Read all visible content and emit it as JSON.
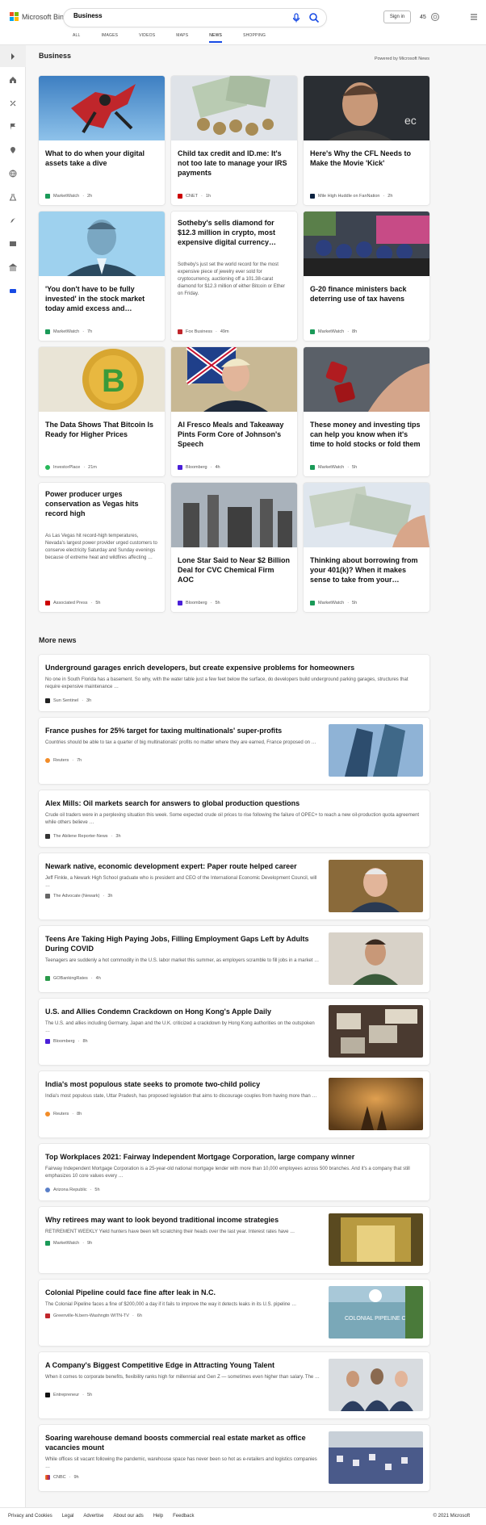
{
  "header": {
    "logo_text": "Microsoft Bing",
    "search_value": "Business",
    "signin_label": "Sign in",
    "rewards_count": "45",
    "tabs": [
      {
        "label": "ALL"
      },
      {
        "label": "IMAGES"
      },
      {
        "label": "VIDEOS"
      },
      {
        "label": "MAPS"
      },
      {
        "label": "NEWS"
      },
      {
        "label": "SHOPPING"
      }
    ],
    "active_tab": "NEWS"
  },
  "rail": {
    "icons": [
      "chevron-right-icon",
      "home-icon",
      "sports-icon",
      "flag-icon",
      "location-icon",
      "globe-icon",
      "science-icon",
      "rocket-icon",
      "entertainment-icon",
      "bank-icon",
      "business-icon"
    ]
  },
  "section": {
    "title": "Business",
    "powered_by": "Powered by Microsoft News"
  },
  "cards": [
    {
      "title": "What to do when your digital assets take a dive",
      "snippet": "",
      "source": "MarketWatch",
      "time": "2h",
      "img": "skydiver"
    },
    {
      "title": "Child tax credit and ID.me: It's not too late to manage your IRS payments",
      "snippet": "",
      "source": "CNET",
      "time": "1h",
      "img": "coins"
    },
    {
      "title": "Here's Why the CFL Needs to Make the Movie 'Kick'",
      "snippet": "",
      "source": "Mile High Huddle on FanNation",
      "time": "2h",
      "img": "man"
    },
    {
      "title": "'You don't have to be fully invested' in the stock market today amid excess and…",
      "snippet": "",
      "source": "MarketWatch",
      "time": "7h",
      "img": "portrait"
    },
    {
      "title": "Sotheby's sells diamond for $12.3 million in crypto, most expensive digital currency…",
      "snippet": "Sotheby's just set the world record for the most expensive piece of jewelry ever sold for cryptocurrency, auctioning off a 101.38-carat diamond for $12.3 million of either Bitcoin or Ether on Friday.",
      "source": "Fox Business",
      "time": "49m",
      "img": ""
    },
    {
      "title": "G-20 finance ministers back deterring use of tax havens",
      "snippet": "",
      "source": "MarketWatch",
      "time": "8h",
      "img": "protest"
    },
    {
      "title": "The Data Shows That Bitcoin Is Ready for Higher Prices",
      "snippet": "",
      "source": "InvestorPlace",
      "time": "21m",
      "img": "bitcoin"
    },
    {
      "title": "Al Fresco Meals and Takeaway Pints Form Core of Johnson's Speech",
      "snippet": "",
      "source": "Bloomberg",
      "time": "4h",
      "img": "johnson"
    },
    {
      "title": "These money and investing tips can help you know when it's time to hold stocks or fold them",
      "snippet": "",
      "source": "MarketWatch",
      "time": "5h",
      "img": "dice"
    },
    {
      "title": "Power producer urges conservation as Vegas hits record high",
      "snippet": "As Las Vegas hit record-high temperatures, Nevada's largest power provider urged customers to conserve electricity Saturday and Sunday evenings because of extreme heat and wildfires affecting …",
      "source": "Associated Press",
      "time": "5h",
      "img": ""
    },
    {
      "title": "Lone Star Said to Near $2 Billion Deal for CVC Chemical Firm AOC",
      "snippet": "",
      "source": "Bloomberg",
      "time": "5h",
      "img": "plant"
    },
    {
      "title": "Thinking about borrowing from your 401(k)? When it makes sense to take from your…",
      "snippet": "",
      "source": "MarketWatch",
      "time": "5h",
      "img": "cash"
    }
  ],
  "more_news_title": "More news",
  "more_news": [
    {
      "title": "Underground garages enrich developers, but create expensive problems for homeowners",
      "snippet": "No one in South Florida has a basement. So why, with the water table just a few feet below the surface, do developers build underground parking garages, structures that require expensive maintenance …",
      "source": "Sun Sentinel",
      "time": "3h",
      "img": ""
    },
    {
      "title": "France pushes for 25% target for taxing multinationals' super-profits",
      "snippet": "Countries should be able to tax a quarter of big multinationals' profits no matter where they are earned, France proposed on …",
      "source": "Reuters",
      "time": "7h",
      "img": "towers"
    },
    {
      "title": "Alex Mills: Oil markets search for answers to global production questions",
      "snippet": "Crude oil traders were in a perplexing situation this week. Some expected crude oil prices to rise following the failure of OPEC+ to reach a new oil-production quota agreement while others believe …",
      "source": "The Abilene Reporter-News",
      "time": "3h",
      "img": ""
    },
    {
      "title": "Newark native, economic development expert: Paper route helped career",
      "snippet": "Jeff Finkle, a Newark High School graduate who is president and CEO of the International Economic Development Council, will …",
      "source": "The Advocate (Newark)",
      "time": "3h",
      "img": "finkle"
    },
    {
      "title": "Teens Are Taking High Paying Jobs, Filling Employment Gaps Left by Adults During COVID",
      "snippet": "Teenagers are suddenly a hot commodity in the U.S. labor market this summer, as employers scramble to fill jobs in a market …",
      "source": "GOBankingRates",
      "time": "4h",
      "img": "teen"
    },
    {
      "title": "U.S. and Allies Condemn Crackdown on Hong Kong's Apple Daily",
      "snippet": "The U.S. and allies including Germany, Japan and the U.K. criticized a crackdown by Hong Kong authorities on the outspoken …",
      "source": "Bloomberg",
      "time": "8h",
      "img": "hongkong"
    },
    {
      "title": "India's most populous state seeks to promote two-child policy",
      "snippet": "India's most populous state, Uttar Pradesh, has proposed legislation that aims to discourage couples from having more than …",
      "source": "Reuters",
      "time": "8h",
      "img": "india"
    },
    {
      "title": "Top Workplaces 2021: Fairway Independent Mortgage Corporation, large company winner",
      "snippet": "Fairway Independent Mortgage Corporation is a 25-year-old national mortgage lender with more than 10,000 employees across 500 branches. And it's a company that still emphasizes 10 core values every …",
      "source": "Arizona Republic",
      "time": "5h",
      "img": ""
    },
    {
      "title": "Why retirees may want to look beyond traditional income strategies",
      "snippet": "RETIREMENT WEEKLY Yield hunters have been left scratching their heads over the last year. Interest rates have …",
      "source": "MarketWatch",
      "time": "9h",
      "img": "vault"
    },
    {
      "title": "Colonial Pipeline could face fine after leak in N.C.",
      "snippet": "The Colonial Pipeline faces a fine of $200,000 a day if it fails to improve the way it detects leaks in its U.S. pipeline …",
      "source": "Greenville-N.bern-Washngtn WITN-TV",
      "time": "6h",
      "img": "colonial"
    },
    {
      "title": "A Company's Biggest Competitive Edge in Attracting Young Talent",
      "snippet": "When it comes to corporate benefits, flexibility ranks high for millennial and Gen Z — sometimes even higher than salary. The …",
      "source": "Entrepreneur",
      "time": "5h",
      "img": "office"
    },
    {
      "title": "Soaring warehouse demand boosts commercial real estate market as office vacancies mount",
      "snippet": "While offices sit vacant following the pandemic, warehouse space has never been so hot as e-retailers and logistics companies …",
      "source": "CNBC",
      "time": "9h",
      "img": "warehouse"
    }
  ],
  "footer": {
    "links": [
      "Privacy and Cookies",
      "Legal",
      "Advertise",
      "About our ads",
      "Help",
      "Feedback"
    ],
    "copyright": "© 2021 Microsoft"
  }
}
